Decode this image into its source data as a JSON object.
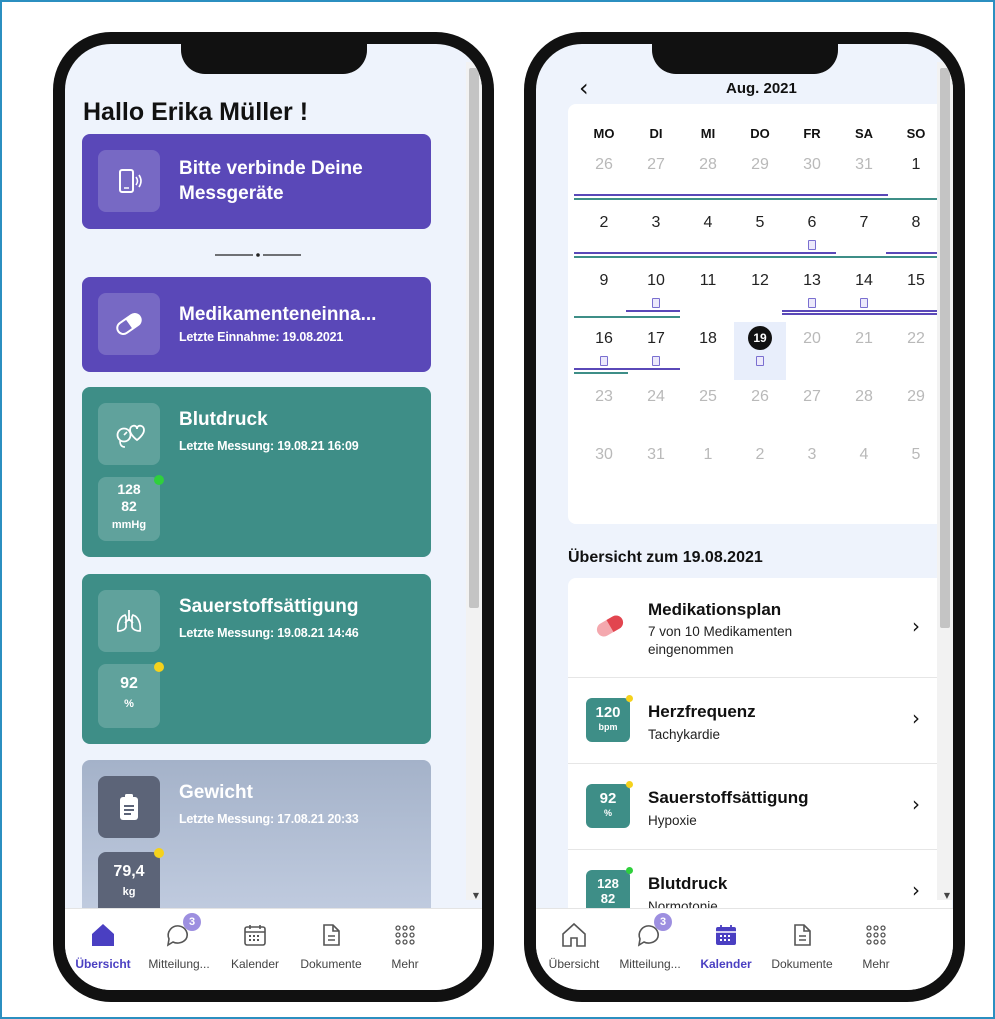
{
  "left": {
    "greeting": "Hallo Erika Müller !",
    "connect_card": {
      "title": "Bitte verbinde Deine Messgeräte"
    },
    "medication_card": {
      "title": "Medikamenteneinna...",
      "subtitle": "Letzte Einnahme: 19.08.2021"
    },
    "blood_pressure_card": {
      "title": "Blutdruck",
      "subtitle": "Letzte Messung: 19.08.21 16:09",
      "value1": "128",
      "value2": "82",
      "unit": "mmHg",
      "status_color": "#2fd03c"
    },
    "oxygen_card": {
      "title": "Sauerstoffsättigung",
      "subtitle": "Letzte Messung: 19.08.21 14:46",
      "value": "92",
      "unit": "%",
      "status_color": "#f5d21c"
    },
    "weight_card": {
      "title": "Gewicht",
      "subtitle": "Letzte Messung: 17.08.21 20:33",
      "value": "79,4",
      "unit": "kg",
      "status_color": "#f5d21c"
    },
    "tabs": [
      {
        "label": "Übersicht",
        "icon": "home-icon",
        "active": true
      },
      {
        "label": "Mitteilung...",
        "icon": "chat-icon",
        "badge": "3"
      },
      {
        "label": "Kalender",
        "icon": "calendar-icon"
      },
      {
        "label": "Dokumente",
        "icon": "document-icon"
      },
      {
        "label": "Mehr",
        "icon": "grid-icon"
      }
    ]
  },
  "right": {
    "month": "Aug. 2021",
    "weekdays": [
      "MO",
      "DI",
      "MI",
      "DO",
      "FR",
      "SA",
      "SO"
    ],
    "weeks": [
      [
        "26",
        "27",
        "28",
        "29",
        "30",
        "31",
        "1"
      ],
      [
        "2",
        "3",
        "4",
        "5",
        "6",
        "7",
        "8"
      ],
      [
        "9",
        "10",
        "11",
        "12",
        "13",
        "14",
        "15"
      ],
      [
        "16",
        "17",
        "18",
        "19",
        "20",
        "21",
        "22"
      ],
      [
        "23",
        "24",
        "25",
        "26",
        "27",
        "28",
        "29"
      ],
      [
        "30",
        "31",
        "1",
        "2",
        "3",
        "4",
        "5"
      ]
    ],
    "today": "19",
    "overview_title": "Übersicht zum 19.08.2021",
    "items": [
      {
        "title": "Medikationsplan",
        "subtitle": "7 von 10 Medikamenten eingenommen",
        "icon": "pill-icon"
      },
      {
        "title": "Herzfrequenz",
        "subtitle": "Tachykardie",
        "value": "120",
        "unit": "bpm",
        "status_color": "#f5d21c"
      },
      {
        "title": "Sauerstoffsättigung",
        "subtitle": "Hypoxie",
        "value": "92",
        "unit": "%",
        "status_color": "#f5d21c"
      },
      {
        "title": "Blutdruck",
        "subtitle": "Normotonie",
        "value": "128",
        "value2": "82",
        "status_color": "#2fd03c"
      }
    ],
    "tabs": [
      {
        "label": "Übersicht",
        "icon": "home-icon"
      },
      {
        "label": "Mitteilung...",
        "icon": "chat-icon",
        "badge": "3"
      },
      {
        "label": "Kalender",
        "icon": "calendar-icon",
        "active": true
      },
      {
        "label": "Dokumente",
        "icon": "document-icon"
      },
      {
        "label": "Mehr",
        "icon": "grid-icon"
      }
    ]
  },
  "colors": {
    "purple": "#5a48b8",
    "teal": "#3e8e87",
    "gray_card": "#a4b2c9",
    "accent": "#4a3fc2"
  }
}
